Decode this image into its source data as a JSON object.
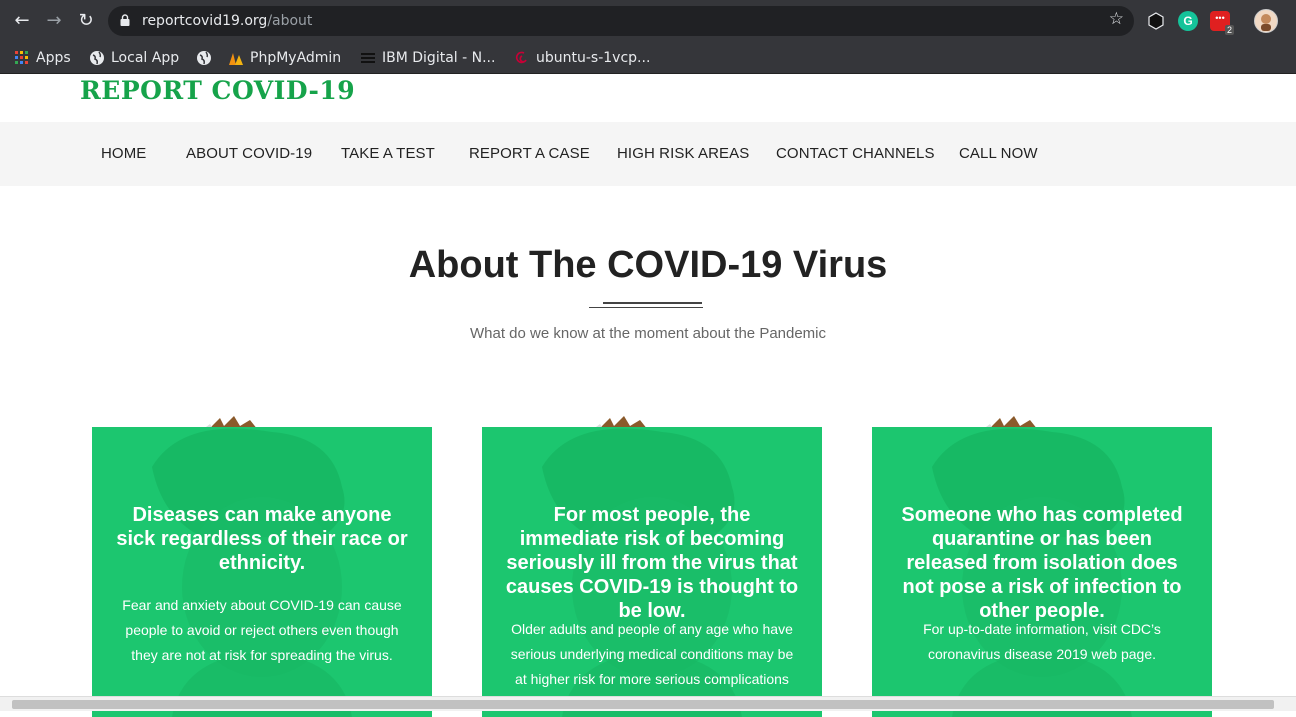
{
  "browser": {
    "url_host": "reportcovid19.org",
    "url_path": "/about",
    "bookmarks": [
      {
        "label": "Apps",
        "icon": "apps-grid-icon"
      },
      {
        "label": "Local App",
        "icon": "globe-icon"
      },
      {
        "label": "",
        "icon": "globe-icon"
      },
      {
        "label": "PhpMyAdmin",
        "icon": "phpmyadmin-icon"
      },
      {
        "label": "IBM Digital - N...",
        "icon": "ibm-icon"
      },
      {
        "label": "ubuntu-s-1vcp...",
        "icon": "debian-swirl-icon"
      }
    ],
    "extension_badge": "2"
  },
  "site": {
    "logo": "REPORT COVID-19",
    "brand_color": "#16a34a",
    "card_color": "#1cc66f"
  },
  "menu": {
    "items": [
      "HOME",
      "ABOUT COVID-19",
      "TAKE A TEST",
      "REPORT A CASE",
      "HIGH RISK AREAS",
      "CONTACT CHANNELS",
      "CALL NOW"
    ]
  },
  "section": {
    "title": "About The COVID-19 Virus",
    "subtitle": "What do we know at the moment about the Pandemic"
  },
  "cards": [
    {
      "title": "Diseases can make anyone sick regardless of their race or ethnicity.",
      "text": "Fear and anxiety about COVID-19 can cause people to avoid or reject others even though they are not at risk for spreading the virus."
    },
    {
      "title": "For most people, the immediate risk of becoming seriously ill from the virus that causes COVID-19 is thought to be low.",
      "text": "Older adults and people of any age who have serious underlying medical conditions may be at higher risk for more serious complications from"
    },
    {
      "title": "Someone who has completed quarantine or has been released from isolation does not pose a risk of infection to other people.",
      "text": "For up-to-date information, visit CDC’s coronavirus disease 2019 web page."
    }
  ]
}
